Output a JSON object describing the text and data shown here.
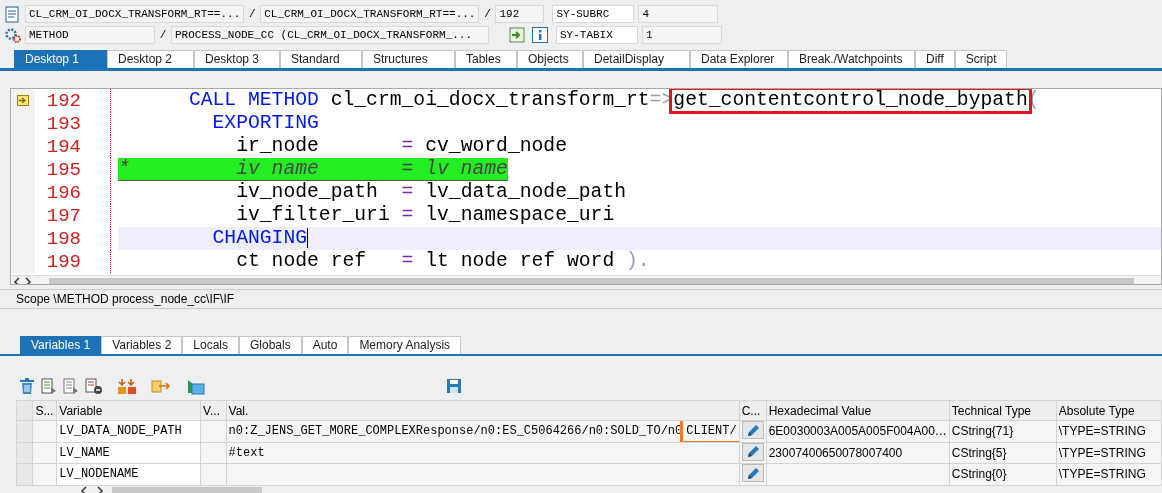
{
  "header": {
    "rows": [
      {
        "fields": [
          {
            "text": "CL_CRM_OI_DOCX_TRANSFORM_RT==..."
          },
          {
            "sep": "/",
            "text": "CL_CRM_OI_DOCX_TRANSFORM_RT==..."
          },
          {
            "sep": "/",
            "text": "192"
          }
        ],
        "sys_field": "SY-SUBRC",
        "sys_value": "4"
      },
      {
        "fields": [
          {
            "text": "METHOD"
          },
          {
            "sep": "/",
            "text": "PROCESS_NODE_CC (CL_CRM_OI_DOCX_TRANSFORM_..."
          }
        ],
        "sys_field": "SY-TABIX",
        "sys_value": "1"
      }
    ]
  },
  "desktop_tabs": [
    {
      "label": "Desktop 1",
      "selected": true
    },
    {
      "label": "Desktop 2",
      "selected": false
    },
    {
      "label": "Desktop 3",
      "selected": false
    },
    {
      "label": "Standard",
      "selected": false
    },
    {
      "label": "Structures",
      "selected": false
    },
    {
      "label": "Tables",
      "selected": false
    },
    {
      "label": "Objects",
      "selected": false
    },
    {
      "label": "DetailDisplay",
      "selected": false
    },
    {
      "label": "Data Explorer",
      "selected": false
    },
    {
      "label": "Break./Watchpoints",
      "selected": false
    },
    {
      "label": "Diff",
      "selected": false
    },
    {
      "label": "Script",
      "selected": false
    }
  ],
  "code": {
    "lines": [
      {
        "number": "192",
        "execution_pointer": true,
        "current_line": false,
        "commented": false,
        "tokens": [
          {
            "kind": "keyword",
            "text": "      CALL METHOD"
          },
          {
            "kind": "plain",
            "text": " cl_crm_oi_docx_transform_rt"
          },
          {
            "kind": "punct",
            "text": "=>"
          },
          {
            "kind": "marked",
            "text": "get_contentcontrol_node_bypath"
          },
          {
            "kind": "punct",
            "text": "("
          }
        ]
      },
      {
        "number": "193",
        "execution_pointer": false,
        "current_line": false,
        "commented": false,
        "tokens": [
          {
            "kind": "keyword",
            "text": "        EXPORTING"
          }
        ]
      },
      {
        "number": "194",
        "execution_pointer": false,
        "current_line": false,
        "commented": false,
        "tokens": [
          {
            "kind": "plain",
            "text": "          ir_node       "
          },
          {
            "kind": "op",
            "text": "="
          },
          {
            "kind": "plain",
            "text": " cv_word_node"
          }
        ]
      },
      {
        "number": "195",
        "execution_pointer": false,
        "current_line": false,
        "commented": true,
        "tokens": [
          {
            "kind": "plain",
            "text": "*         iv name       = lv name"
          }
        ]
      },
      {
        "number": "196",
        "execution_pointer": false,
        "current_line": false,
        "commented": false,
        "tokens": [
          {
            "kind": "plain",
            "text": "          iv_node_path  "
          },
          {
            "kind": "op",
            "text": "="
          },
          {
            "kind": "plain",
            "text": " lv_data_node_path"
          }
        ]
      },
      {
        "number": "197",
        "execution_pointer": false,
        "current_line": false,
        "commented": false,
        "tokens": [
          {
            "kind": "plain",
            "text": "          iv_filter_uri "
          },
          {
            "kind": "op",
            "text": "="
          },
          {
            "kind": "plain",
            "text": " lv_namespace_uri"
          }
        ]
      },
      {
        "number": "198",
        "execution_pointer": false,
        "current_line": true,
        "commented": false,
        "tokens": [
          {
            "kind": "keyword",
            "text": "        CHANGING"
          }
        ]
      },
      {
        "number": "199",
        "execution_pointer": false,
        "current_line": false,
        "commented": false,
        "tokens": [
          {
            "kind": "plain",
            "text": "          ct node ref   "
          },
          {
            "kind": "op",
            "text": "="
          },
          {
            "kind": "plain",
            "text": " lt node ref word "
          },
          {
            "kind": "punct",
            "text": ")."
          }
        ]
      }
    ]
  },
  "scope": "Scope \\METHOD process_node_cc\\IF\\IF",
  "variable_tabs": [
    {
      "label": "Variables 1",
      "selected": true
    },
    {
      "label": "Variables 2",
      "selected": false
    },
    {
      "label": "Locals",
      "selected": false
    },
    {
      "label": "Globals",
      "selected": false
    },
    {
      "label": "Auto",
      "selected": false
    },
    {
      "label": "Memory Analysis",
      "selected": false
    }
  ],
  "table": {
    "columns": [
      "S...",
      "Variable",
      "V...",
      "Val.",
      "C...",
      "Hexadecimal Value",
      "Technical Type",
      "Absolute Type"
    ],
    "rows": [
      {
        "variable": "LV_DATA_NODE_PATH",
        "value": "n0:Z_JENS_GET_MORE_COMPLEXResponse/n0:ES_C5064266/n0:SOLD_TO/n0",
        "value_marked": "CLIENT/",
        "hex": "6E0030003A005A005F004A00…",
        "technical_type": "CString{71}",
        "absolute_type": "\\TYPE=STRING"
      },
      {
        "variable": "LV_NAME",
        "value": "#text",
        "hex": "23007400650078007400",
        "technical_type": "CString{5}",
        "absolute_type": "\\TYPE=STRING"
      },
      {
        "variable": "LV_NODENAME",
        "technical_type": "CString{0}",
        "absolute_type": "\\TYPE=STRING"
      }
    ]
  }
}
